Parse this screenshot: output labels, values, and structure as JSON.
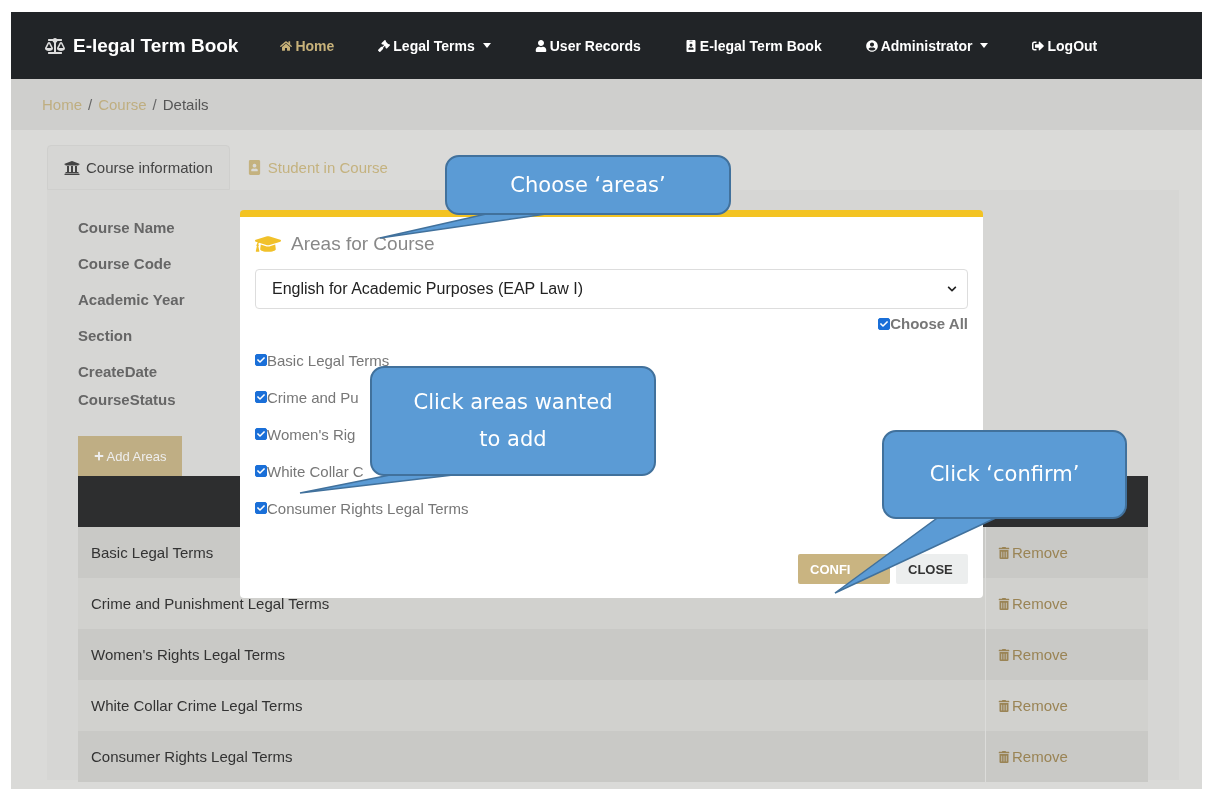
{
  "navbar": {
    "brand": "E-legal Term Book",
    "items": [
      {
        "label": "Home",
        "selected": true,
        "dropdown": false
      },
      {
        "label": "Legal Terms",
        "selected": false,
        "dropdown": true
      },
      {
        "label": "User Records",
        "selected": false,
        "dropdown": false
      },
      {
        "label": "E-legal Term Book",
        "selected": false,
        "dropdown": false
      },
      {
        "label": "Administrator",
        "selected": false,
        "dropdown": true
      },
      {
        "label": "LogOut",
        "selected": false,
        "dropdown": false
      }
    ]
  },
  "breadcrumb": [
    {
      "label": "Home",
      "kind": "link"
    },
    {
      "label": "/",
      "kind": "separator"
    },
    {
      "label": "Course",
      "kind": "link"
    },
    {
      "label": "/",
      "kind": "separator"
    },
    {
      "label": "Details",
      "kind": "current"
    }
  ],
  "tabs": [
    {
      "label": "Course information",
      "selected": true
    },
    {
      "label": "Student in Course",
      "selected": false
    }
  ],
  "details": [
    "Course Name",
    "Course Code",
    "Academic Year",
    "Section",
    "CreateDate",
    "CourseStatus"
  ],
  "add_button": "Add Areas",
  "table": {
    "rows": [
      {
        "name": "Basic Legal Terms",
        "action": "Remove"
      },
      {
        "name": "Crime and Punishment Legal Terms",
        "action": "Remove"
      },
      {
        "name": "Women's Rights Legal Terms",
        "action": "Remove"
      },
      {
        "name": "White Collar Crime Legal Terms",
        "action": "Remove"
      },
      {
        "name": "Consumer Rights Legal Terms",
        "action": "Remove"
      }
    ]
  },
  "modal": {
    "title": "Areas for Course",
    "select": {
      "value": "English for Academic Purposes (EAP Law I)"
    },
    "choose_all": {
      "label": "Choose All",
      "checked": true
    },
    "areas": [
      {
        "label": "Basic Legal Terms",
        "checked": true
      },
      {
        "label": "Crime and Pu",
        "checked": true
      },
      {
        "label": "Women's Rig",
        "checked": true
      },
      {
        "label": "White Collar C",
        "checked": true
      },
      {
        "label": "Consumer Rights Legal Terms",
        "checked": true
      }
    ],
    "buttons": [
      {
        "label": "CONFI",
        "kind": "confirm"
      },
      {
        "label": "CLOSE",
        "kind": "close"
      }
    ]
  },
  "callouts": [
    {
      "text": "Choose  ‘areas’"
    },
    {
      "text": "Click areas wanted to add"
    },
    {
      "text": "Click ‘confirm’"
    }
  ]
}
